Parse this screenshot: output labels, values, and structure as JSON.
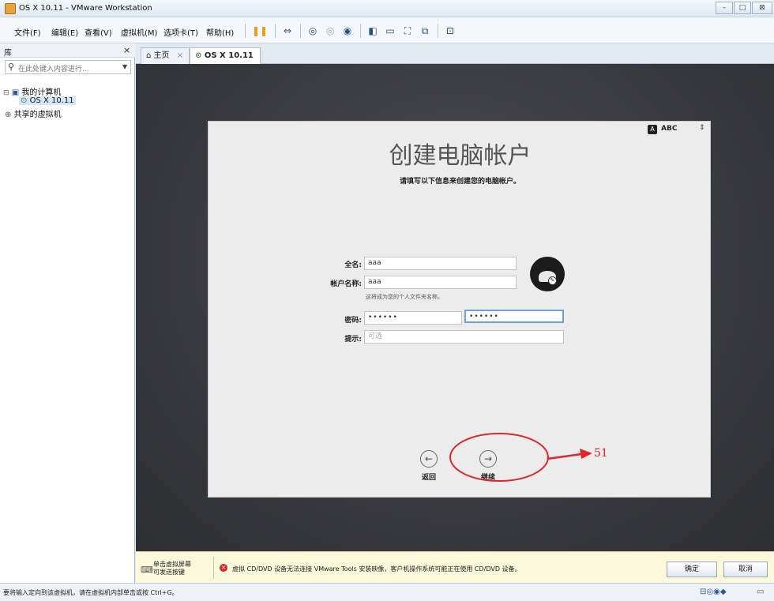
{
  "window": {
    "title": "OS X 10.11 - VMware Workstation"
  },
  "menu": [
    "文件(F)",
    "编辑(E)",
    "查看(V)",
    "虚拟机(M)",
    "选项卡(T)",
    "帮助(H)"
  ],
  "library": {
    "title": "库",
    "close": "×",
    "search_placeholder": "在此处键入内容进行...",
    "tree": {
      "root": "我的计算机",
      "vm": "OS X 10.11",
      "shared": "共享的虚拟机"
    }
  },
  "tabs": [
    {
      "label": "主页",
      "close": "×"
    },
    {
      "label": "OS X 10.11",
      "close": "×"
    }
  ],
  "setup": {
    "input_source": "ABC",
    "heading": "创建电脑帐户",
    "subheading": "请填写以下信息来创建您的电脑帐户。",
    "fullname_label": "全名:",
    "fullname_value": "aaa",
    "account_label": "帐户名称:",
    "account_value": "aaa",
    "account_hint": "这将成为您的个人文件夹名称。",
    "password_label": "密码:",
    "password_value": "••••••",
    "verify_value": "••••••",
    "hint_label": "提示:",
    "hint_placeholder": "可选",
    "back_label": "返回",
    "continue_label": "继续"
  },
  "annotation": {
    "label": "51",
    "color": "#e0262a"
  },
  "notice": {
    "left_text_1": "单击虚拟屏幕",
    "left_text_2": "可发送按键",
    "message": "虚拟 CD/DVD 设备无法连接 VMware Tools 安装映像，客户机操作系统可能正在使用 CD/DVD 设备。",
    "ok_button": "确定",
    "cancel_button": "取消"
  },
  "status": {
    "text": "要将输入定向到该虚拟机，请在虚拟机内部单击或按 Ctrl+G。"
  }
}
